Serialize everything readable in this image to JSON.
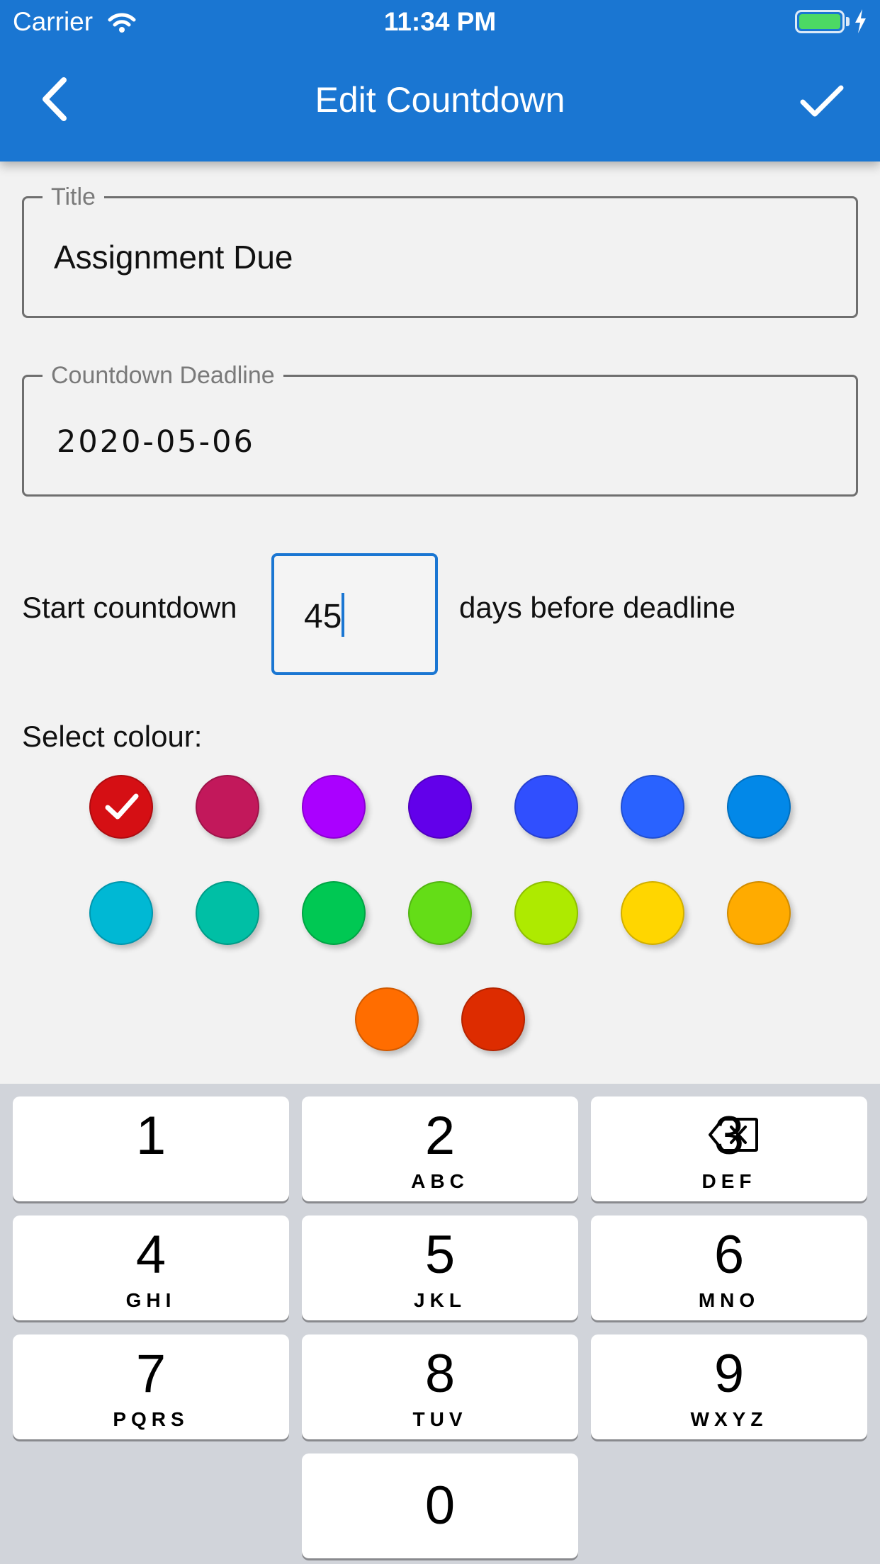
{
  "status_bar": {
    "carrier": "Carrier",
    "time": "11:34 PM",
    "icons": [
      "wifi-icon",
      "battery-icon",
      "charging-bolt-icon"
    ]
  },
  "app_bar": {
    "title": "Edit Countdown",
    "back_icon": "chevron-left-icon",
    "done_icon": "checkmark-icon",
    "color": "#1a76d2"
  },
  "form": {
    "title_label": "Title",
    "title_value": "Assignment Due",
    "deadline_label": "Countdown Deadline",
    "deadline_value": "2020-05-06",
    "start_label": "Start countdown",
    "days_value": "45",
    "days_suffix": "days before deadline",
    "colour_label": "Select colour:",
    "selected_colour_index": 0,
    "colours": [
      "#d50f14",
      "#c2185b",
      "#aa00ff",
      "#6200ea",
      "#304ffe",
      "#2962ff",
      "#0288e8",
      "#00b8d4",
      "#00bfa5",
      "#00c853",
      "#64dd17",
      "#aeea00",
      "#ffd600",
      "#ffab00",
      "#ff6d00",
      "#dd2c00"
    ]
  },
  "keyboard": {
    "keys": [
      {
        "digit": "1",
        "letters": ""
      },
      {
        "digit": "2",
        "letters": "ABC"
      },
      {
        "digit": "3",
        "letters": "DEF"
      },
      {
        "digit": "4",
        "letters": "GHI"
      },
      {
        "digit": "5",
        "letters": "JKL"
      },
      {
        "digit": "6",
        "letters": "MNO"
      },
      {
        "digit": "7",
        "letters": "PQRS"
      },
      {
        "digit": "8",
        "letters": "TUV"
      },
      {
        "digit": "9",
        "letters": "WXYZ"
      },
      {
        "digit": "0",
        "letters": ""
      }
    ],
    "delete_icon": "backspace-icon"
  }
}
